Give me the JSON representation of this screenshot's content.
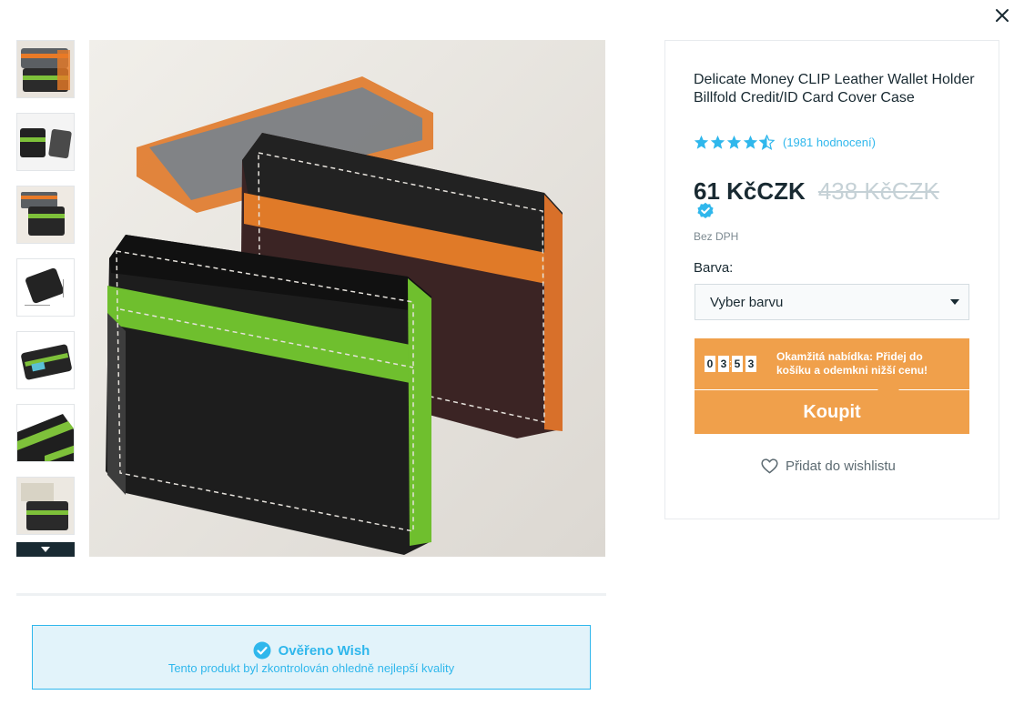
{
  "close": {
    "icon": "close-icon"
  },
  "gallery": {
    "thumbnails": [
      {
        "icon": "wallet-thumb-1"
      },
      {
        "icon": "wallet-thumb-2"
      },
      {
        "icon": "wallet-thumb-3"
      },
      {
        "icon": "wallet-thumb-4"
      },
      {
        "icon": "wallet-thumb-5"
      },
      {
        "icon": "wallet-thumb-6"
      },
      {
        "icon": "wallet-thumb-7"
      }
    ],
    "scroll_icon": "chevron-down-icon"
  },
  "product": {
    "title": "Delicate Money CLIP Leather Wallet Holder Billfold Credit/ID Card Cover Case",
    "rating_value": 4.5,
    "rating_count": "(1981 hodnocení)",
    "price_current": "61 KčCZK",
    "price_old": "438 KčCZK",
    "vat_note": "Bez DPH",
    "color_label": "Barva:",
    "color_select": "Vyber barvu",
    "offer": {
      "digits": [
        "0",
        "3",
        "5",
        "3"
      ],
      "separator": ":",
      "text": "Okamžitá nabídka: Přidej do košíku a odemkni nižší cenu!"
    },
    "buy_label": "Koupit",
    "wishlist_label": "Přidat do wishlistu"
  },
  "verified": {
    "title": "Ověřeno Wish",
    "subtitle": "Tento produkt byl zkontrolován ohledně nejlepší kvality"
  },
  "colors": {
    "accent_orange": "#f0a04b",
    "brand_blue": "#2fb7ec",
    "text_dark": "#192a32"
  }
}
